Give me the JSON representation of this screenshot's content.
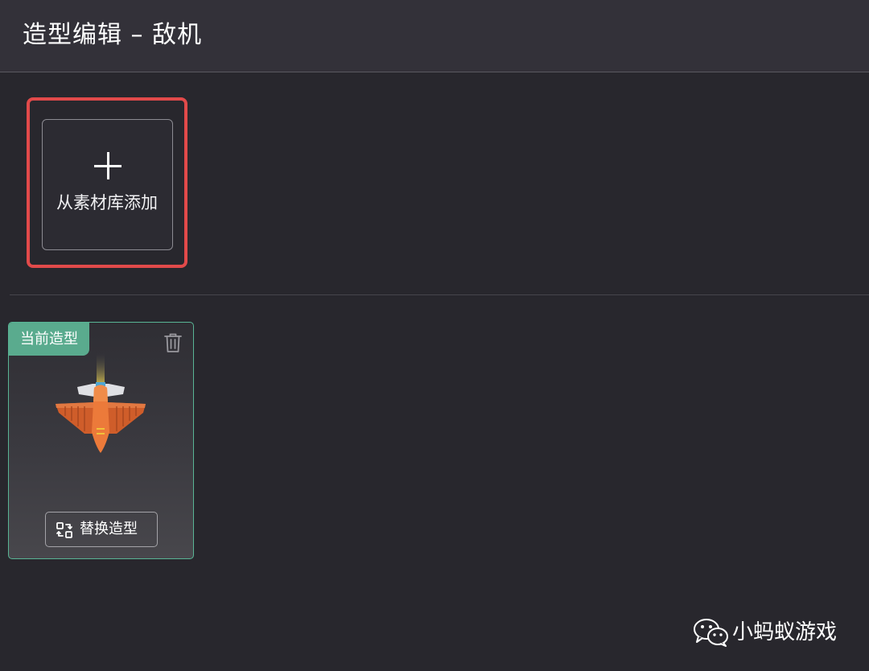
{
  "header": {
    "title": "造型编辑 – 敌机"
  },
  "add_from_library": {
    "label": "从素材库添加",
    "icon": "plus-icon"
  },
  "costume_card": {
    "badge": "当前造型",
    "delete_icon": "trash-icon",
    "image": "enemy-plane",
    "replace_button": {
      "label": "替换造型",
      "icon": "swap-icon"
    }
  },
  "watermark": {
    "text": "小蚂蚁游戏",
    "icon": "wechat-icon"
  },
  "colors": {
    "background": "#28272d",
    "header": "#333139",
    "highlight": "#e24a4a",
    "card_border": "#59b595",
    "badge": "#5aab8e",
    "plane": "#e8733a"
  }
}
